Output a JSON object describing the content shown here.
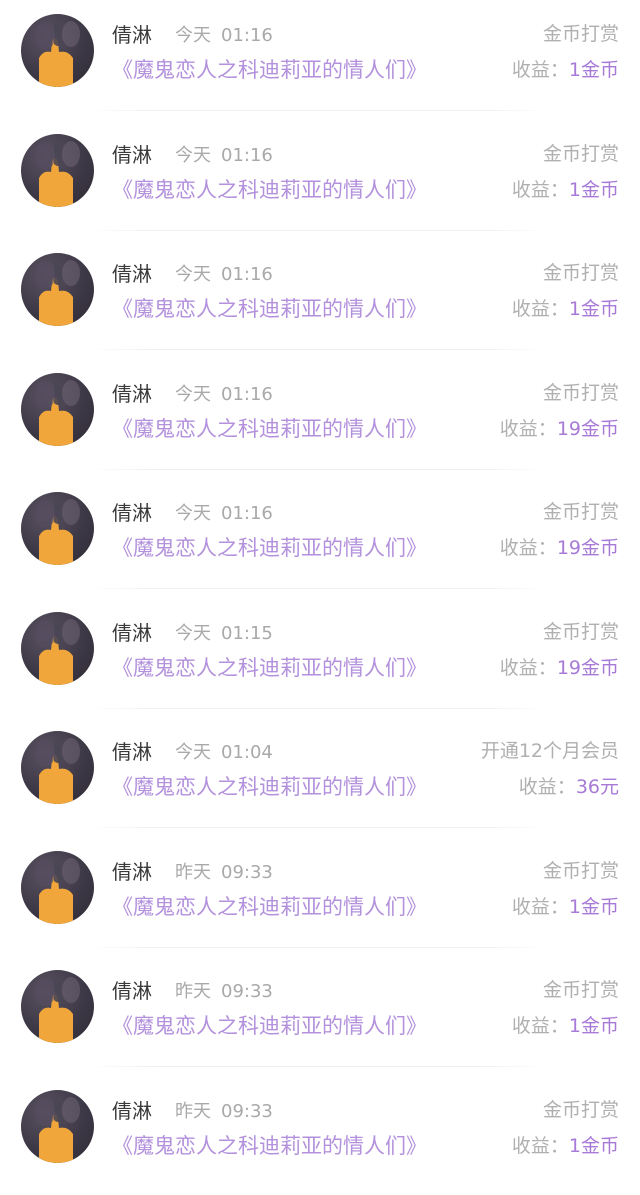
{
  "records": [
    {
      "name": "倩淋",
      "day": "今天",
      "time": "01:16",
      "title": "《魔鬼恋人之科迪莉亚的情人们》",
      "type": "金币打赏",
      "income_label": "收益：",
      "income_amount": "1金币"
    },
    {
      "name": "倩淋",
      "day": "今天",
      "time": "01:16",
      "title": "《魔鬼恋人之科迪莉亚的情人们》",
      "type": "金币打赏",
      "income_label": "收益：",
      "income_amount": "1金币"
    },
    {
      "name": "倩淋",
      "day": "今天",
      "time": "01:16",
      "title": "《魔鬼恋人之科迪莉亚的情人们》",
      "type": "金币打赏",
      "income_label": "收益：",
      "income_amount": "1金币"
    },
    {
      "name": "倩淋",
      "day": "今天",
      "time": "01:16",
      "title": "《魔鬼恋人之科迪莉亚的情人们》",
      "type": "金币打赏",
      "income_label": "收益：",
      "income_amount": "19金币"
    },
    {
      "name": "倩淋",
      "day": "今天",
      "time": "01:16",
      "title": "《魔鬼恋人之科迪莉亚的情人们》",
      "type": "金币打赏",
      "income_label": "收益：",
      "income_amount": "19金币"
    },
    {
      "name": "倩淋",
      "day": "今天",
      "time": "01:15",
      "title": "《魔鬼恋人之科迪莉亚的情人们》",
      "type": "金币打赏",
      "income_label": "收益：",
      "income_amount": "19金币"
    },
    {
      "name": "倩淋",
      "day": "今天",
      "time": "01:04",
      "title": "《魔鬼恋人之科迪莉亚的情人们》",
      "type": "开通12个月会员",
      "income_label": "收益：",
      "income_amount": "36元"
    },
    {
      "name": "倩淋",
      "day": "昨天",
      "time": "09:33",
      "title": "《魔鬼恋人之科迪莉亚的情人们》",
      "type": "金币打赏",
      "income_label": "收益：",
      "income_amount": "1金币"
    },
    {
      "name": "倩淋",
      "day": "昨天",
      "time": "09:33",
      "title": "《魔鬼恋人之科迪莉亚的情人们》",
      "type": "金币打赏",
      "income_label": "收益：",
      "income_amount": "1金币"
    },
    {
      "name": "倩淋",
      "day": "昨天",
      "time": "09:33",
      "title": "《魔鬼恋人之科迪莉亚的情人们》",
      "type": "金币打赏",
      "income_label": "收益：",
      "income_amount": "1金币"
    }
  ],
  "colors": {
    "title": "#b391dc",
    "income_amount": "#a87ad7",
    "muted": "#a9a9a9",
    "name": "#3a3a3a"
  },
  "icons": {
    "avatar": "user-avatar-photo"
  }
}
